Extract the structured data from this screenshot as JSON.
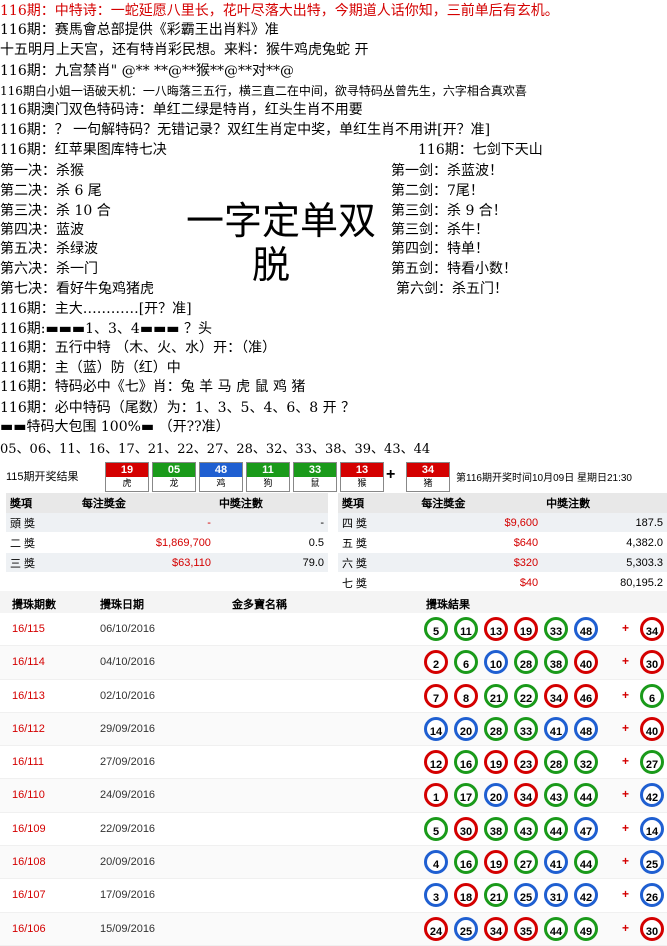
{
  "lines": [
    "116期：中特诗：一蛇延愿八里长，花叶尽落大出特，今期道人话你知，三前单后有玄机。",
    "116期：赛馬會总部提供《彩霸王出肖料》准",
    "十五明月上天宫，还有特肖彩民想。来料：猴牛鸡虎兔蛇 开",
    "116期：九宫禁肖\" @** **@**猴**@**对**@",
    "116期白小姐一语破天机：一八晦落三五行，横三直二在中间，欲寻特码丛曾先生，六字相合真欢喜",
    "116期澳门双色特码诗：单红二绿是特肖，红头生肖不用要",
    "116期：？ 一句解特码？无错记录？双红生肖定中奖，单红生肖不用讲[开？准]",
    "116期：红苹果图库特七决"
  ],
  "jian_title": "116期：七剑下天山",
  "jue": [
    "第一决：杀猴",
    "第二决：杀 6 尾",
    "第三决：杀 10 合",
    "第四决：蓝波",
    "第五决：杀绿波",
    "第六决：杀一门",
    "第七决：看好牛兔鸡猪虎"
  ],
  "jian": [
    "第一剑：杀蓝波！",
    "第二剑：7尾！",
    "第三剑：杀 9 合！",
    "第三剑：杀牛！",
    "第四剑：特单！",
    "第五剑：特看小数！",
    "第六剑：杀五门！"
  ],
  "big_text": [
    "一字定单双",
    "脱"
  ],
  "lines2": [
    "116期：主大…………[开？准]",
    "116期:▬▬▬1、3、4▬▬▬ ？头",
    "116期：五行中特 （木、火、水）开：（准）",
    "116期：主（蓝）防（红）中",
    "116期：特码必中《七》肖：兔 羊 马 虎 鼠 鸡 猪",
    "116期：必中特码（尾数）为：1、3、5、4、6、8 开 ？",
    "▬▬特码大包围 100%▬ （开??准）"
  ],
  "numbers_line": "05、06、11、16、17、21、22、27、28、32、33、38、39、43、44",
  "draw": {
    "label": "115期开奖结果",
    "balls": [
      {
        "num": "19",
        "zodiac": "虎",
        "color": "#d40000"
      },
      {
        "num": "05",
        "zodiac": "龙",
        "color": "#1a9a1a"
      },
      {
        "num": "48",
        "zodiac": "鸡",
        "color": "#1f5fd1"
      },
      {
        "num": "11",
        "zodiac": "狗",
        "color": "#1a9a1a"
      },
      {
        "num": "33",
        "zodiac": "鼠",
        "color": "#1a9a1a"
      },
      {
        "num": "13",
        "zodiac": "猴",
        "color": "#d40000"
      },
      {
        "num": "34",
        "zodiac": "猪",
        "color": "#d40000"
      }
    ],
    "plus": "+",
    "info": "第116期开奖时间10月09日 星期日21:30"
  },
  "prize_left": {
    "headers": [
      "獎項",
      "每注獎金",
      "中獎注數"
    ],
    "rows": [
      [
        "頭 獎",
        "-",
        "-"
      ],
      [
        "二 獎",
        "$1,869,700",
        "0.5"
      ],
      [
        "三 獎",
        "$63,110",
        "79.0"
      ]
    ]
  },
  "prize_right": {
    "headers": [
      "獎項",
      "每注獎金",
      "中獎注數"
    ],
    "rows": [
      [
        "四 獎",
        "$9,600",
        "187.5"
      ],
      [
        "五 獎",
        "$640",
        "4,382.0"
      ],
      [
        "六 獎",
        "$320",
        "5,303.3"
      ],
      [
        "七 獎",
        "$40",
        "80,195.2"
      ]
    ]
  },
  "history": {
    "headers": [
      "攪珠期數",
      "攪珠日期",
      "金多寶名稱",
      "攪珠結果"
    ],
    "plus": "+",
    "rows": [
      {
        "issue": "16/115",
        "date": "06/10/2016",
        "balls": [
          "5",
          "11",
          "13",
          "19",
          "33",
          "48"
        ],
        "special": "34"
      },
      {
        "issue": "16/114",
        "date": "04/10/2016",
        "balls": [
          "2",
          "6",
          "10",
          "28",
          "38",
          "40"
        ],
        "special": "30"
      },
      {
        "issue": "16/113",
        "date": "02/10/2016",
        "balls": [
          "7",
          "8",
          "21",
          "22",
          "34",
          "46"
        ],
        "special": "6"
      },
      {
        "issue": "16/112",
        "date": "29/09/2016",
        "balls": [
          "14",
          "20",
          "28",
          "33",
          "41",
          "48"
        ],
        "special": "40"
      },
      {
        "issue": "16/111",
        "date": "27/09/2016",
        "balls": [
          "12",
          "16",
          "19",
          "23",
          "28",
          "32"
        ],
        "special": "27"
      },
      {
        "issue": "16/110",
        "date": "24/09/2016",
        "balls": [
          "1",
          "17",
          "20",
          "34",
          "43",
          "44"
        ],
        "special": "42"
      },
      {
        "issue": "16/109",
        "date": "22/09/2016",
        "balls": [
          "5",
          "30",
          "38",
          "43",
          "44",
          "47"
        ],
        "special": "14"
      },
      {
        "issue": "16/108",
        "date": "20/09/2016",
        "balls": [
          "4",
          "16",
          "19",
          "27",
          "41",
          "44"
        ],
        "special": "25"
      },
      {
        "issue": "16/107",
        "date": "17/09/2016",
        "balls": [
          "3",
          "18",
          "21",
          "25",
          "31",
          "42"
        ],
        "special": "26"
      },
      {
        "issue": "16/106",
        "date": "15/09/2016",
        "balls": [
          "24",
          "25",
          "34",
          "35",
          "44",
          "49"
        ],
        "special": "30"
      }
    ]
  }
}
